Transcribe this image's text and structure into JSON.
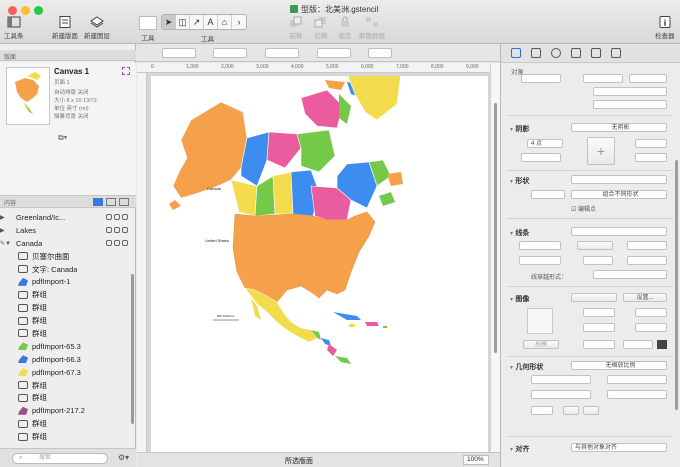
{
  "window": {
    "title": "型版：北美洲.gstencil"
  },
  "toolbar": {
    "toolbox_label": "工具条",
    "new_canvas_label": "新建版面",
    "new_layer_label": "新建图层",
    "style_label": "工具",
    "tools_label": "工具",
    "front_label": "前移",
    "back_label": "后移",
    "lock_label": "锁定",
    "ungroup_label": "解散群组",
    "inspector_label": "检查器"
  },
  "sidebar": {
    "canvases_header": "版面",
    "canvas": {
      "name": "Canvas 1",
      "page": "页面 1",
      "autosize": "自动排版 关闭",
      "size": "大小 8 x 10 13/72",
      "units": "单位 英寸 (mi)",
      "tracing": "描摹背景 关闭"
    },
    "layers_header": "内容",
    "search_placeholder": "搜索",
    "layers": [
      {
        "label": "Greenland/Ic...",
        "level": "top"
      },
      {
        "label": "Lakes",
        "level": "top"
      },
      {
        "label": "Canada",
        "level": "top"
      },
      {
        "label": "贝塞尔曲面",
        "level": "child"
      },
      {
        "label": "文字: Canada",
        "level": "child"
      },
      {
        "label": "pdfImport-1",
        "level": "child"
      },
      {
        "label": "群组",
        "level": "child"
      },
      {
        "label": "群组",
        "level": "child"
      },
      {
        "label": "群组",
        "level": "child"
      },
      {
        "label": "群组",
        "level": "child"
      },
      {
        "label": "pdfImport-65.3",
        "level": "child"
      },
      {
        "label": "pdfImport-66.3",
        "level": "child"
      },
      {
        "label": "pdfImport-67.3",
        "level": "child"
      },
      {
        "label": "群组",
        "level": "child"
      },
      {
        "label": "群组",
        "level": "child"
      },
      {
        "label": "pdfImport-217.2",
        "level": "child"
      },
      {
        "label": "群组",
        "level": "child"
      },
      {
        "label": "群组",
        "level": "child"
      }
    ]
  },
  "ruler": {
    "marks": [
      "0",
      "1,000",
      "2,000",
      "3,000",
      "4,000",
      "5,000",
      "6,000",
      "7,000",
      "8,000",
      "9,000"
    ]
  },
  "map": {
    "label_canada": "Canada",
    "label_us": "United States",
    "scale_label": "500   1000 km"
  },
  "status": {
    "selection": "所选版面",
    "zoom": "100%"
  },
  "inspector": {
    "object_label": "对象",
    "shadow_section": "阴影",
    "shadow_type": "无阴影",
    "shadow_size": "4 点",
    "shape_section": "形状",
    "shape_combine": "组合不同形状",
    "shape_edit_points": "编辑点",
    "lines_section": "线条",
    "line_style": "线穿越形式：",
    "image_section": "图像",
    "image_settings": "设置...",
    "image_fit": "拇模",
    "geometry_section": "几何形状",
    "geometry_scale": "无格放比例",
    "align_section": "对齐",
    "align_value": "与其他对象对齐"
  }
}
